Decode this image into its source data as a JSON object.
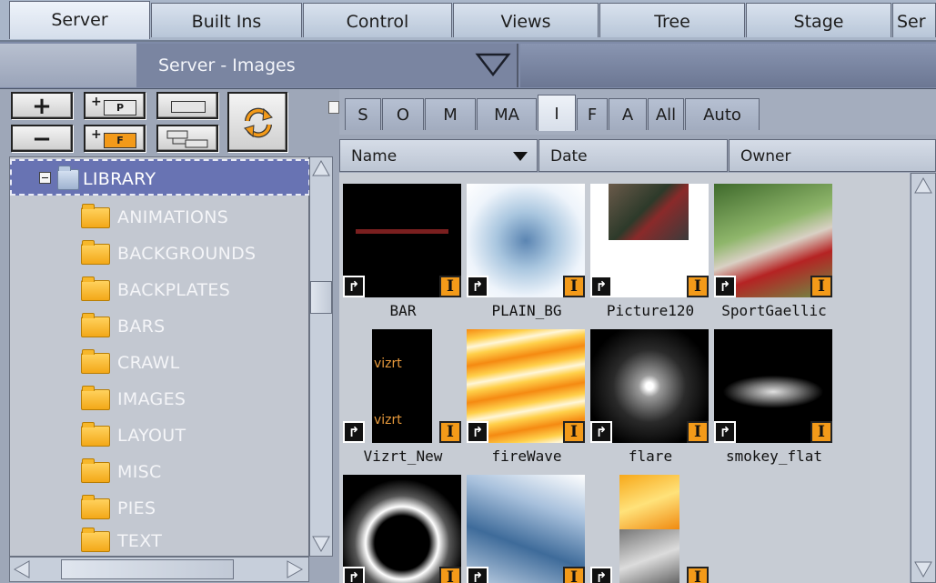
{
  "main_tabs": [
    {
      "label": "Server",
      "active": true
    },
    {
      "label": "Built Ins",
      "active": false
    },
    {
      "label": "Control",
      "active": false
    },
    {
      "label": "Views",
      "active": false
    },
    {
      "label": "Tree",
      "active": false
    },
    {
      "label": "Stage",
      "active": false
    },
    {
      "label": "Ser",
      "active": false
    }
  ],
  "section": {
    "title": "Server - Images",
    "dropdown_icon": "triangle-down-icon"
  },
  "tools": {
    "add": {
      "glyph": "+",
      "icon": "add-icon"
    },
    "remove": {
      "glyph": "−",
      "icon": "remove-icon"
    },
    "new_project": {
      "glyph": "P",
      "icon": "new-project-icon"
    },
    "new_folder": {
      "glyph": "F",
      "icon": "new-folder-icon"
    },
    "layout_a": {
      "icon": "layout-icon"
    },
    "layout_b": {
      "icon": "tree-layout-icon"
    },
    "refresh": {
      "icon": "refresh-icon"
    }
  },
  "tree": {
    "root": {
      "label": "LIBRARY",
      "expanded": true,
      "selected": true
    },
    "folders": [
      "ANIMATIONS",
      "BACKGROUNDS",
      "BACKPLATES",
      "BARS",
      "CRAWL",
      "IMAGES",
      "LAYOUT",
      "MISC",
      "PIES",
      "TEXT"
    ]
  },
  "filter_tabs": [
    {
      "label": "S",
      "active": false
    },
    {
      "label": "O",
      "active": false
    },
    {
      "label": "M",
      "active": false
    },
    {
      "label": "MA",
      "active": false
    },
    {
      "label": "I",
      "active": true
    },
    {
      "label": "F",
      "active": false
    },
    {
      "label": "A",
      "active": false
    },
    {
      "label": "All",
      "active": false
    },
    {
      "label": "Auto",
      "active": false
    }
  ],
  "columns": {
    "name": "Name",
    "date": "Date",
    "owner": "Owner",
    "sort_icon": "sort-down-icon"
  },
  "images": [
    {
      "name": "BAR",
      "badge": "I"
    },
    {
      "name": "PLAIN_BG",
      "badge": "I"
    },
    {
      "name": "Picture120",
      "badge": "I"
    },
    {
      "name": "SportGaellic",
      "badge": "I"
    },
    {
      "name": "Vizrt_New",
      "badge": "I",
      "overlay_text": "vizrt"
    },
    {
      "name": "fireWave",
      "badge": "I"
    },
    {
      "name": "flare",
      "badge": "I"
    },
    {
      "name": "smokey_flat",
      "badge": "I"
    },
    {
      "name": "",
      "badge": "I"
    },
    {
      "name": "",
      "badge": "I"
    },
    {
      "name": "",
      "badge": "I"
    }
  ],
  "colors": {
    "badge": "#f39a19",
    "selection": "#6873b3",
    "panel": "#c3c8d1"
  }
}
